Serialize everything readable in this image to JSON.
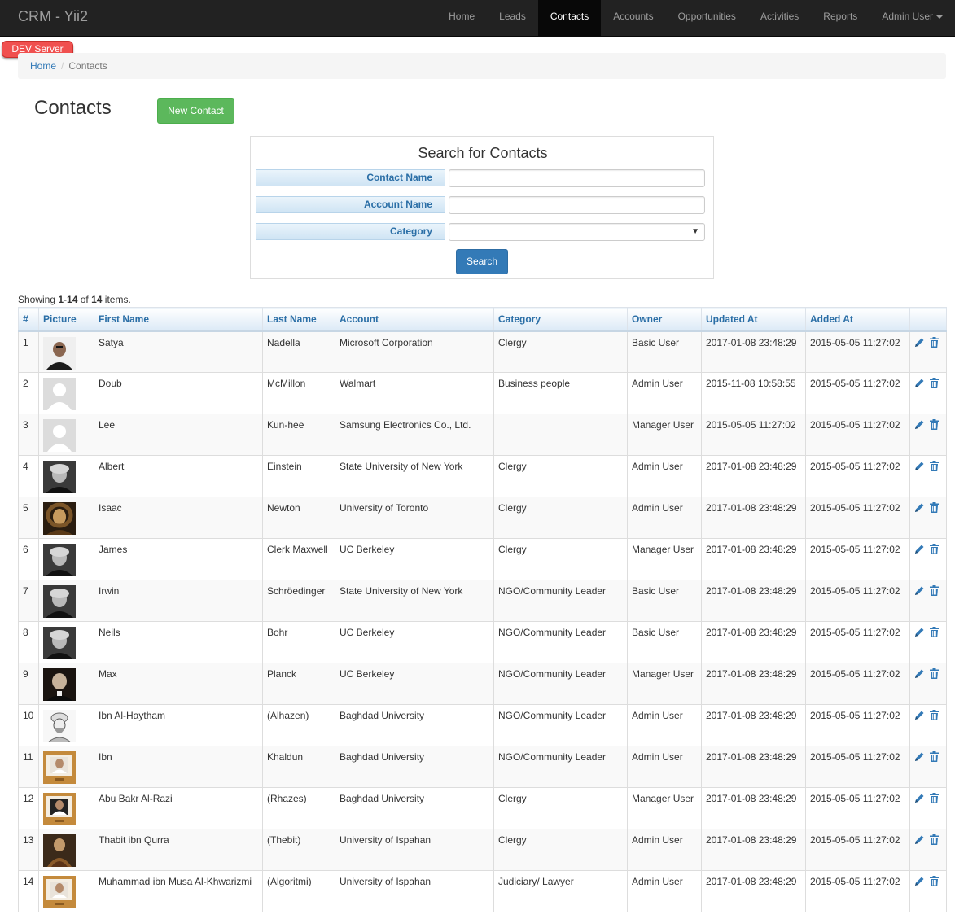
{
  "navbar": {
    "brand": "CRM - Yii2",
    "items": [
      "Home",
      "Leads",
      "Contacts",
      "Accounts",
      "Opportunities",
      "Activities",
      "Reports",
      "Admin User"
    ]
  },
  "dev_badge": "DEV  Server",
  "breadcrumb": {
    "home": "Home",
    "current": "Contacts"
  },
  "page": {
    "title": "Contacts",
    "new_button": "New Contact"
  },
  "search": {
    "title": "Search for Contacts",
    "contact_name_label": "Contact Name",
    "account_name_label": "Account Name",
    "category_label": "Category",
    "contact_name_value": "",
    "account_name_value": "",
    "category_value": "",
    "button": "Search"
  },
  "summary": {
    "prefix": "Showing ",
    "range": "1-14",
    "mid": " of ",
    "total": "14",
    "suffix": " items."
  },
  "table": {
    "headers": [
      "#",
      "Picture",
      "First Name",
      "Last Name",
      "Account",
      "Category",
      "Owner",
      "Updated At",
      "Added At",
      ""
    ],
    "rows": [
      {
        "num": "1",
        "pic": "photo-dark-bald",
        "first": "Satya",
        "last": "Nadella",
        "account": "Microsoft Corporation",
        "category": "Clergy",
        "owner": "Basic User",
        "updated": "2017-01-08 23:48:29",
        "added": "2015-05-05 11:27:02"
      },
      {
        "num": "2",
        "pic": "placeholder",
        "first": "Doub",
        "last": "McMillon",
        "account": "Walmart",
        "category": "Business people",
        "owner": "Admin User",
        "updated": "2015-11-08 10:58:55",
        "added": "2015-05-05 11:27:02"
      },
      {
        "num": "3",
        "pic": "placeholder",
        "first": "Lee",
        "last": "Kun-hee",
        "account": "Samsung Electronics Co., Ltd.",
        "category": "",
        "owner": "Manager User",
        "updated": "2015-05-05 11:27:02",
        "added": "2015-05-05 11:27:02"
      },
      {
        "num": "4",
        "pic": "photo-bw",
        "first": "Albert",
        "last": "Einstein",
        "account": "State University of New York",
        "category": "Clergy",
        "owner": "Admin User",
        "updated": "2017-01-08 23:48:29",
        "added": "2015-05-05 11:27:02"
      },
      {
        "num": "5",
        "pic": "photo-brown",
        "first": "Isaac",
        "last": "Newton",
        "account": "University of Toronto",
        "category": "Clergy",
        "owner": "Admin User",
        "updated": "2017-01-08 23:48:29",
        "added": "2015-05-05 11:27:02"
      },
      {
        "num": "6",
        "pic": "photo-bw",
        "first": "James",
        "last": "Clerk Maxwell",
        "account": "UC Berkeley",
        "category": "Clergy",
        "owner": "Manager User",
        "updated": "2017-01-08 23:48:29",
        "added": "2015-05-05 11:27:02"
      },
      {
        "num": "7",
        "pic": "photo-bw",
        "first": "Irwin",
        "last": "Schröedinger",
        "account": "State University of New York",
        "category": "NGO/Community Leader",
        "owner": "Basic User",
        "updated": "2017-01-08 23:48:29",
        "added": "2015-05-05 11:27:02"
      },
      {
        "num": "8",
        "pic": "photo-bw",
        "first": "Neils",
        "last": "Bohr",
        "account": "UC Berkeley",
        "category": "NGO/Community Leader",
        "owner": "Basic User",
        "updated": "2017-01-08 23:48:29",
        "added": "2015-05-05 11:27:02"
      },
      {
        "num": "9",
        "pic": "photo-dark",
        "first": "Max",
        "last": "Planck",
        "account": "UC Berkeley",
        "category": "NGO/Community Leader",
        "owner": "Manager User",
        "updated": "2017-01-08 23:48:29",
        "added": "2015-05-05 11:27:02"
      },
      {
        "num": "10",
        "pic": "drawing",
        "first": "Ibn Al-Haytham",
        "last": "(Alhazen)",
        "account": "Baghdad University",
        "category": "NGO/Community Leader",
        "owner": "Admin User",
        "updated": "2017-01-08 23:48:29",
        "added": "2015-05-05 11:27:02"
      },
      {
        "num": "11",
        "pic": "framed",
        "first": "Ibn",
        "last": "Khaldun",
        "account": "Baghdad University",
        "category": "NGO/Community Leader",
        "owner": "Admin User",
        "updated": "2017-01-08 23:48:29",
        "added": "2015-05-05 11:27:02"
      },
      {
        "num": "12",
        "pic": "framed-dark",
        "first": "Abu Bakr Al-Razi",
        "last": "(Rhazes)",
        "account": "Baghdad University",
        "category": "Clergy",
        "owner": "Manager User",
        "updated": "2017-01-08 23:48:29",
        "added": "2015-05-05 11:27:02"
      },
      {
        "num": "13",
        "pic": "painting",
        "first": "Thabit ibn Qurra",
        "last": "(Thebit)",
        "account": "University of Ispahan",
        "category": "Clergy",
        "owner": "Admin User",
        "updated": "2017-01-08 23:48:29",
        "added": "2015-05-05 11:27:02"
      },
      {
        "num": "14",
        "pic": "framed",
        "first": "Muhammad ibn Musa Al-Khwarizmi",
        "last": "(Algoritmi)",
        "account": "University of Ispahan",
        "category": "Judiciary/ Lawyer",
        "owner": "Admin User",
        "updated": "2017-01-08 23:48:29",
        "added": "2015-05-05 11:27:02"
      }
    ]
  },
  "colors": {
    "navbar_bg": "#222222",
    "link": "#337ab7",
    "new_button": "#5cb85c",
    "dev_badge": "#f0504f"
  },
  "icons": {
    "edit": "pencil-icon",
    "delete": "trash-icon",
    "dropdown": "caret-down-icon"
  }
}
